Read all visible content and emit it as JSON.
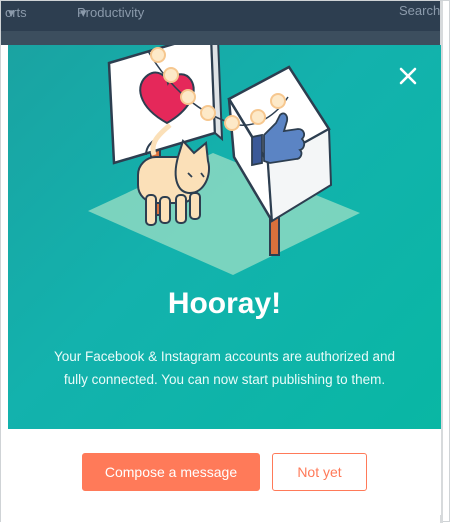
{
  "nav": {
    "left_label": "orts",
    "middle_label": "Productivity",
    "right_label": "Search"
  },
  "modal": {
    "title": "Hooray!",
    "body": "Your Facebook & Instagram accounts are authorized and fully connected. You can now start publishing to them.",
    "close_icon": "close-icon",
    "primary_button": "Compose a message",
    "secondary_button": "Not yet"
  },
  "illustration": {
    "left_sign_icon": "heart-icon",
    "right_sign_icon": "thumbs-up-icon",
    "character": "cat"
  },
  "colors": {
    "hero_teal": "#13b2ad",
    "accent_orange": "#ff7a59",
    "nav_dark": "#2d3e50"
  }
}
